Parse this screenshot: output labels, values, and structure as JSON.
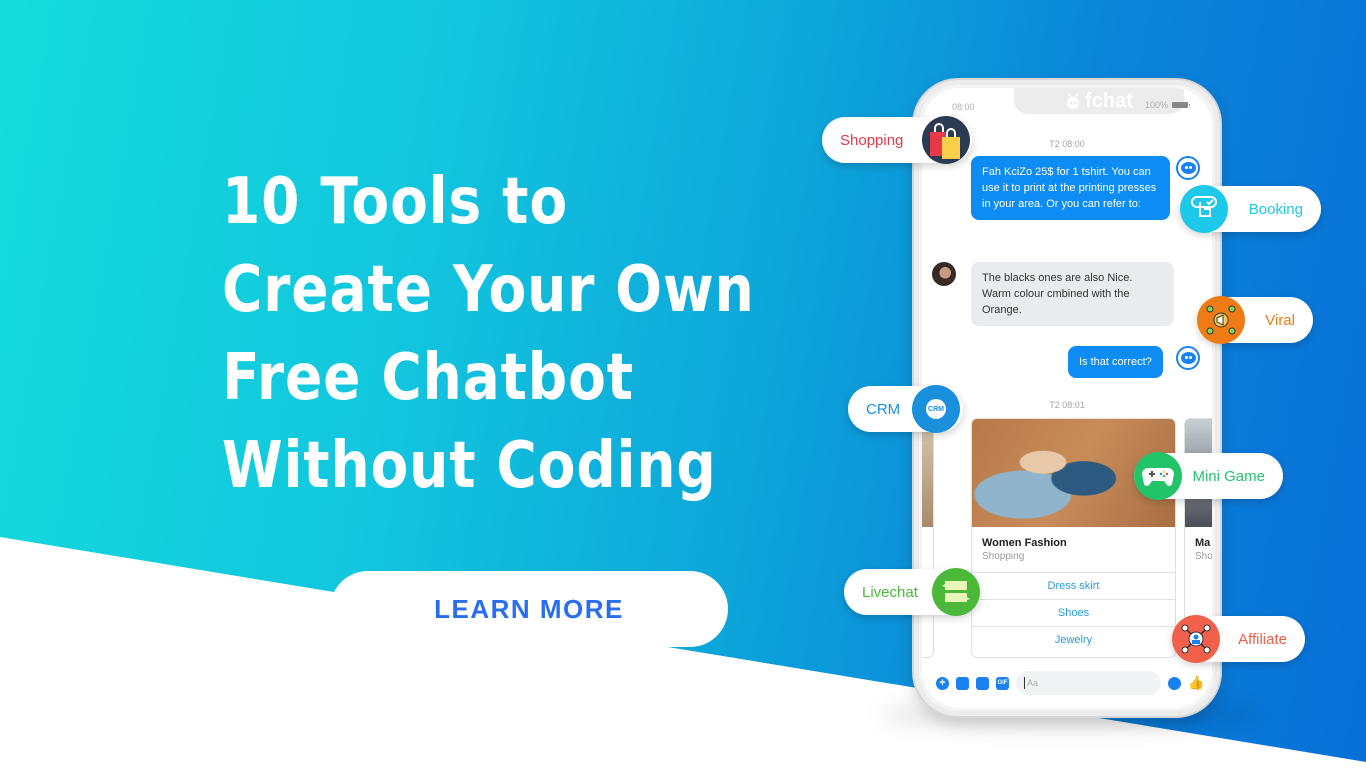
{
  "headline": {
    "lines": [
      "10 Tools to",
      "Create Your Own",
      "Free Chatbot",
      "Without Coding"
    ]
  },
  "cta": {
    "label": "LEARN MORE"
  },
  "colors": {
    "bg_left": "#14dcdc",
    "bg_right": "#0870d8",
    "cta_text": "#2a6ef0",
    "bubble_out": "#0d8cf4",
    "bubble_in": "#e9ebee"
  },
  "phone": {
    "status_time": "08:00",
    "brand": "fchat",
    "battery": "100%",
    "timestamps": [
      "T2 08:00",
      "T2 08:01"
    ],
    "messages": [
      {
        "sender": "bot",
        "text": "Fah KciZo 25$ for 1 tshirt. You can use it to print at the printing presses in your area. Or you can refer to:"
      },
      {
        "sender": "user",
        "text": "The blacks ones are also Nice. Warm colour cmbined with the Orange."
      },
      {
        "sender": "bot",
        "text": "Is that correct?"
      }
    ],
    "carousel": {
      "main_card": {
        "title": "Women Fashion",
        "subtitle": "Shopping",
        "buttons": [
          "Dress skirt",
          "Shoes",
          "Jewelry"
        ]
      },
      "next_card": {
        "title": "Ma",
        "subtitle": "Sho"
      }
    },
    "composer": {
      "placeholder": "Aa",
      "icons": [
        "plus-icon",
        "image-icon",
        "sticker-icon",
        "gif-icon",
        "emoji-icon",
        "like-icon"
      ],
      "gif_label": "GIF"
    }
  },
  "features": [
    {
      "label": "Shopping",
      "color": "#e8394a",
      "icon": "shopping-bag-icon"
    },
    {
      "label": "Booking",
      "color": "#1ec8e8",
      "icon": "booking-hand-icon"
    },
    {
      "label": "Viral",
      "color": "#ef7b14",
      "icon": "megaphone-network-icon"
    },
    {
      "label": "CRM",
      "color": "#1a8fdc",
      "icon": "crm-icon",
      "icon_text": "CRM"
    },
    {
      "label": "Mini Game",
      "color": "#22c46a",
      "icon": "gamepad-icon"
    },
    {
      "label": "Livechat",
      "color": "#4bb83a",
      "icon": "chat-bubbles-icon"
    },
    {
      "label": "Affiliate",
      "color": "#f0604a",
      "icon": "affiliate-network-icon"
    }
  ]
}
